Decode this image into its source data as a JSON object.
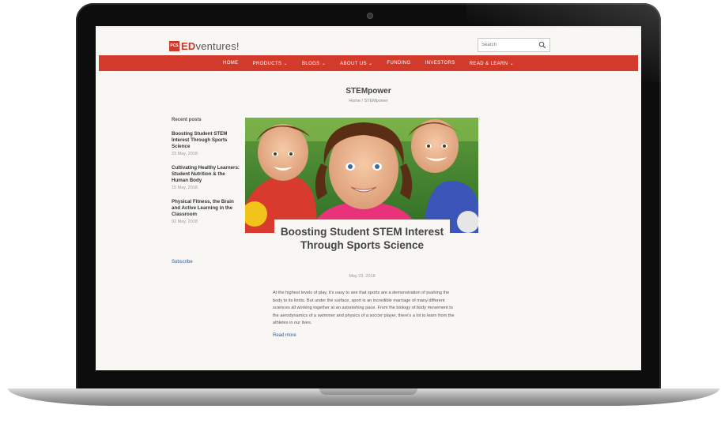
{
  "logo": {
    "badge": "PCS",
    "brand_ed": "ED",
    "brand_rest": "ventures!"
  },
  "search": {
    "placeholder": "Search"
  },
  "nav": {
    "items": [
      "HOME",
      "PRODUCTS ⌄",
      "BLOGS ⌄",
      "ABOUT US ⌄",
      "FUNDING",
      "INVESTORS",
      "READ & LEARN ⌄"
    ]
  },
  "page": {
    "title": "STEMpower",
    "breadcrumb": "Home / STEMpower"
  },
  "sidebar": {
    "heading": "Recent posts",
    "posts": [
      {
        "title": "Boosting Student STEM Interest Through Sports Science",
        "date": "23 May, 2018"
      },
      {
        "title": "Cultivating Healthy Learners: Student Nutrition & the Human Body",
        "date": "15 May, 2018"
      },
      {
        "title": "Physical Fitness, the Brain and Active Learning in the Classroom",
        "date": "02 May, 2018"
      }
    ],
    "subscribe": "Subscribe"
  },
  "article": {
    "title": "Boosting Student STEM Interest Through Sports Science",
    "date": "May 23, 2018",
    "body": "At the highest levels of play, it's easy to see that sports are a demonstration of pushing the body to its limits. But under the surface, sport is an incredible marriage of many different sciences all working together at an astonishing pace. From the biology of body movement to the aerodynamics of a swimmer and physics of a soccer player, there's a lot to learn from the athletes in our lives.",
    "read_more": "Read more"
  },
  "colors": {
    "brand_red": "#d23b2c",
    "link_blue": "#2c5aa0",
    "page_bg": "#f8f7f3"
  },
  "icons": {
    "search": "search-icon",
    "camera": "camera-icon"
  }
}
